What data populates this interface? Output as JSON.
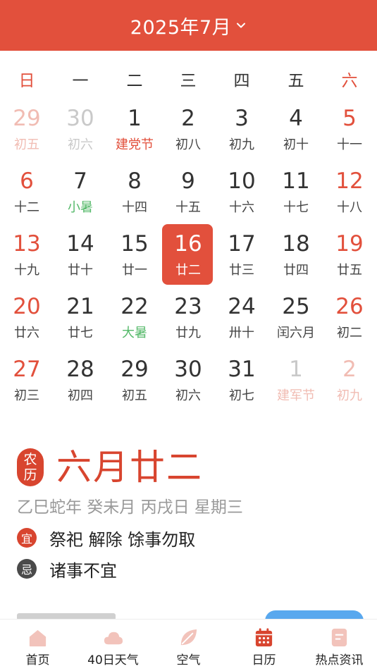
{
  "header": {
    "title": "2025年7月",
    "chevron_icon": "chevron-down-icon"
  },
  "weekdays": [
    "日",
    "一",
    "二",
    "三",
    "四",
    "五",
    "六"
  ],
  "calendar": {
    "rows": [
      [
        {
          "day": "29",
          "lunar": "初五",
          "other": true
        },
        {
          "day": "30",
          "lunar": "初六",
          "other": true
        },
        {
          "day": "1",
          "lunar": "建党节",
          "festival": true
        },
        {
          "day": "2",
          "lunar": "初八"
        },
        {
          "day": "3",
          "lunar": "初九"
        },
        {
          "day": "4",
          "lunar": "初十"
        },
        {
          "day": "5",
          "lunar": "十一"
        }
      ],
      [
        {
          "day": "6",
          "lunar": "十二"
        },
        {
          "day": "7",
          "lunar": "小暑",
          "term": true
        },
        {
          "day": "8",
          "lunar": "十四"
        },
        {
          "day": "9",
          "lunar": "十五"
        },
        {
          "day": "10",
          "lunar": "十六"
        },
        {
          "day": "11",
          "lunar": "十七"
        },
        {
          "day": "12",
          "lunar": "十八"
        }
      ],
      [
        {
          "day": "13",
          "lunar": "十九"
        },
        {
          "day": "14",
          "lunar": "廿十"
        },
        {
          "day": "15",
          "lunar": "廿一"
        },
        {
          "day": "16",
          "lunar": "廿二",
          "selected": true
        },
        {
          "day": "17",
          "lunar": "廿三"
        },
        {
          "day": "18",
          "lunar": "廿四"
        },
        {
          "day": "19",
          "lunar": "廿五"
        }
      ],
      [
        {
          "day": "20",
          "lunar": "廿六"
        },
        {
          "day": "21",
          "lunar": "廿七"
        },
        {
          "day": "22",
          "lunar": "大暑",
          "term": true
        },
        {
          "day": "23",
          "lunar": "廿九"
        },
        {
          "day": "24",
          "lunar": "卅十"
        },
        {
          "day": "25",
          "lunar": "闰六月"
        },
        {
          "day": "26",
          "lunar": "初二"
        }
      ],
      [
        {
          "day": "27",
          "lunar": "初三"
        },
        {
          "day": "28",
          "lunar": "初四"
        },
        {
          "day": "29",
          "lunar": "初五"
        },
        {
          "day": "30",
          "lunar": "初六"
        },
        {
          "day": "31",
          "lunar": "初七"
        },
        {
          "day": "1",
          "lunar": "建军节",
          "other": true,
          "festival": true
        },
        {
          "day": "2",
          "lunar": "初九",
          "other": true
        }
      ]
    ]
  },
  "lunar_info": {
    "seal_top": "农",
    "seal_bottom": "历",
    "date": "六月廿二",
    "ganzhi": "乙巳蛇年 癸未月 丙戌日 星期三",
    "yi_label": "宜",
    "yi_text": "祭祀 解除 馀事勿取",
    "ji_label": "忌",
    "ji_text": "诸事不宜"
  },
  "tabs": [
    {
      "label": "首页",
      "icon": "home-icon"
    },
    {
      "label": "40日天气",
      "icon": "cloud-icon"
    },
    {
      "label": "空气",
      "icon": "leaf-icon"
    },
    {
      "label": "日历",
      "icon": "calendar-icon",
      "active": true
    },
    {
      "label": "热点资讯",
      "icon": "news-icon"
    }
  ],
  "colors": {
    "accent": "#e2503c",
    "solar_term": "#55b96a",
    "tab_inactive": "#f2c3bb",
    "tab_active": "#d8452f"
  }
}
